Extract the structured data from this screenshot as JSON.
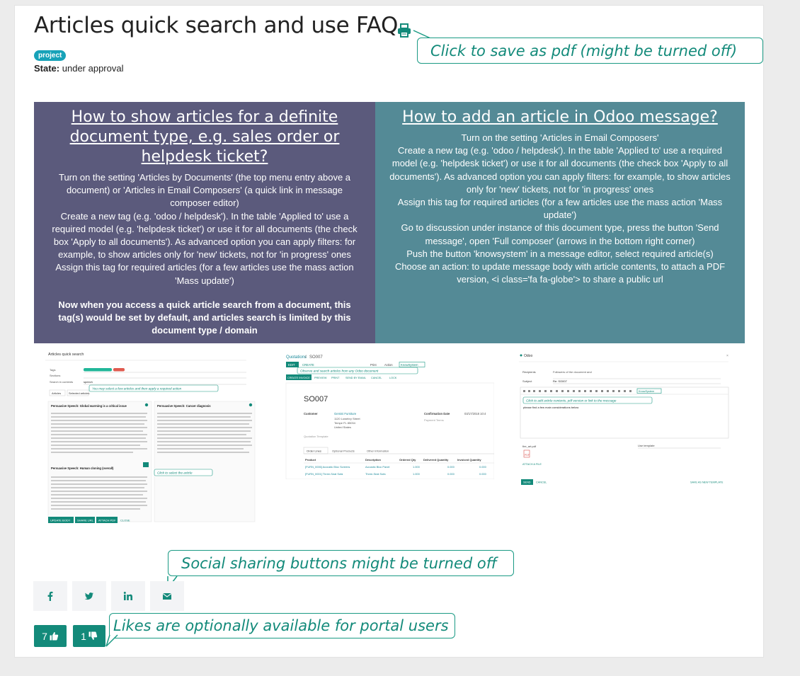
{
  "page": {
    "title": "Articles quick search and use FAQ",
    "tag": "project",
    "state_label": "State:",
    "state_value": "under approval"
  },
  "callouts": {
    "pdf": "Click to save as pdf (might be turned off)",
    "social": "Social sharing buttons might be turned off",
    "likes": "Likes are optionally available for portal users"
  },
  "panels": {
    "left": {
      "heading": "How to show articles for a definite document type, e.g. sales order or helpdesk ticket?",
      "p1": "Turn on the setting 'Articles by Documents' (the top menu entry above a document) or 'Articles in Email Composers' (a quick link in message composer editor)",
      "p2": "Create a new tag (e.g. 'odoo / helpdesk'). In the table 'Applied to' use a required model (e.g. 'helpdesk ticket') or use it for all documents (the check box 'Apply to all documents'). As advanced option you can apply filters: for example, to show articles only for 'new' tickets, not for 'in progress' ones",
      "p3": "Assign this tag for required articles (for a few articles use the mass action 'Mass update')",
      "p4": "Now when you access a quick article search from a document, this tag(s) would be set by default, and articles search is limited by this document type / domain"
    },
    "right": {
      "heading": "How to add an article in Odoo message?",
      "p1": "Turn on the setting 'Articles in Email Composers'",
      "p2": "Create a new tag (e.g. 'odoo / helpdesk'). In the table 'Applied to' use a required model (e.g. 'helpdesk ticket') or use it for all documents (the check box 'Apply to all documents'). As advanced option you can apply filters: for example, to show articles only for 'new' tickets, not for 'in progress' ones",
      "p3": "Assign this tag for required articles (for a few articles use the mass action 'Mass update')",
      "p4": "Go to discussion under instance of this document type, press the button 'Send message', open 'Full composer' (arrows in the bottom right corner)",
      "p5": "Push the button 'knowsystem' in a message editor, select required article(s)",
      "p6": "Choose an action: to update message body with article contents, to attach a PDF version, <i class='fa fa-globe'> to share a public url"
    }
  },
  "shot1": {
    "header": "Articles quick search",
    "tags_label": "Tags",
    "sections_label": "Sections",
    "search_label": "Search in contents",
    "search_value": "speech",
    "tab_articles": "Articles",
    "tab_selected": "Selected articles",
    "hint1": "You may select a few articles and then apply a required action",
    "card1_title": "Persuasive Speech: Global warming is a critical issue",
    "card2_title": "Persuasive Speech: Cancer diagnosis",
    "card3_title": "Persuasive Speech: Human cloning (overall)",
    "hint2": "Click to select the article",
    "btn_update": "UPDATE BODY",
    "btn_share": "SHARE URL",
    "btn_attach": "ATTACH PDF",
    "btn_close": "CLOSE"
  },
  "shot2": {
    "breadcrumb_root": "Quotations",
    "breadcrumb_sep": " / ",
    "breadcrumb_id": "SO007",
    "edit": "EDIT",
    "create": "CREATE",
    "print": "Print",
    "action": "Action",
    "knowsystem": "KnowSystem",
    "hint": "Observe and search articles from any Odoo document",
    "toolbar": [
      "CREATE INVOICE",
      "PREVIEW",
      "PRINT",
      "SEND BY EMAIL",
      "CANCEL",
      "LOCK"
    ],
    "so_title": "SO007",
    "customer_label": "Customer",
    "customer_value": "Gemini Furniture",
    "address": [
      "1120 Lowebry Street",
      "Tempe FL 85034",
      "United States"
    ],
    "confirmation_label": "Confirmation Date",
    "confirmation_value": "03/17/2018 10:4",
    "payment_terms": "Payment Terms",
    "quotation_template": "Quotation Template",
    "tabs": [
      "Order Lines",
      "Optional Products",
      "Other Information"
    ],
    "columns": [
      "Product",
      "Description",
      "Ordered Qty",
      "Delivered Quantity",
      "Invoiced Quantity"
    ],
    "rows": [
      [
        "[FURN_0006] Acoustic Bloc Screens",
        "Acoustic Bloc Panel",
        "1.000",
        "0.000",
        "0.000"
      ],
      [
        "[FURN_0001] Three-Seat Sofa",
        "Three-Seat Sofa",
        "1.000",
        "0.000",
        "0.000"
      ]
    ]
  },
  "shot3": {
    "title": "Odoo",
    "recipients_label": "Recipients",
    "recipients_value": "Followers of the document and",
    "subject_label": "Subject",
    "subject_value": "Re: SO007",
    "knowsystem": "KnowSystem",
    "hint": "Click to add article contents, pdf version or link to the message",
    "body": "please find a few main considerations below",
    "attachment": "fire_art.pdf",
    "template": "Use template",
    "attach_files": "ATTACH A FILE",
    "send": "SEND",
    "cancel": "CANCEL",
    "save_template": "SAVE AS NEW TEMPLATE"
  },
  "likes": {
    "likes_count": "7",
    "dislikes_count": "1"
  },
  "colors": {
    "accent": "#138a7a",
    "tag": "#17a2b8",
    "left_panel": "#5b5a7c",
    "right_panel": "#548a96",
    "share_icon": "#138a7a"
  },
  "icons": {
    "print": "print-icon",
    "facebook": "facebook-icon",
    "twitter": "twitter-icon",
    "linkedin": "linkedin-icon",
    "email": "envelope-icon",
    "like": "thumbs-up-icon",
    "dislike": "thumbs-down-icon"
  }
}
